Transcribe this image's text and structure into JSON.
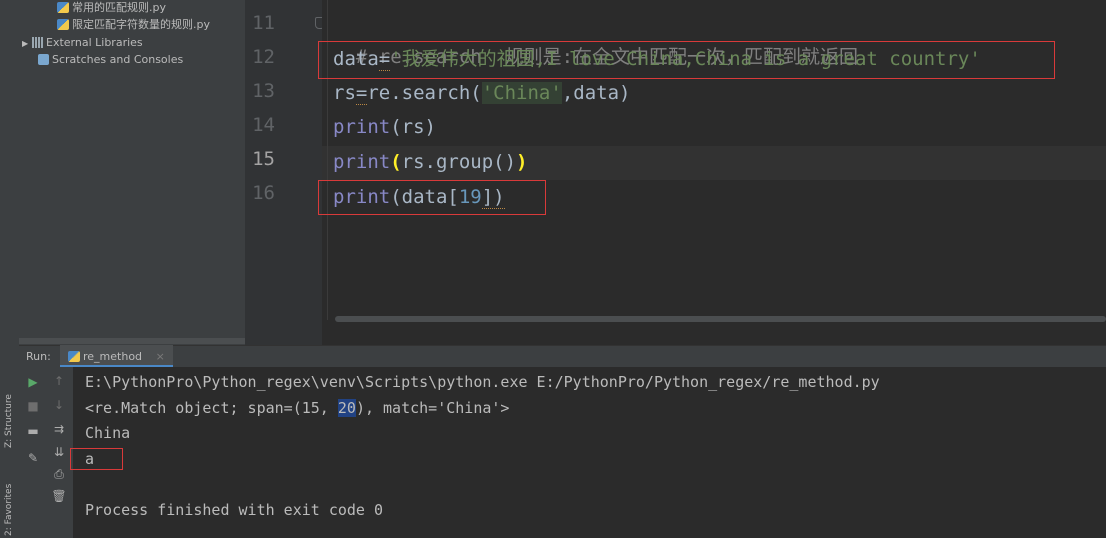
{
  "project_tree": {
    "items": [
      {
        "label": "常用的匹配规则.py",
        "icon": "python-file-icon"
      },
      {
        "label": "限定匹配字符数量的规则.py",
        "icon": "python-file-icon"
      },
      {
        "label": "External Libraries",
        "icon": "library-icon"
      },
      {
        "label": "Scratches and Consoles",
        "icon": "scratches-icon"
      }
    ]
  },
  "editor": {
    "line_numbers": [
      "11",
      "12",
      "13",
      "14",
      "15",
      "16"
    ],
    "current_line": "15",
    "lines": {
      "l11_comment": "# re.search  规则是:在全文中匹配一次，匹配到就返回",
      "l12_var": "data",
      "l12_eq": "=",
      "l12_str": "'我爱伟大的祖国,I love China,China is a great country'",
      "l13_var": "rs",
      "l13_eq": "=",
      "l13_call": "re.search(",
      "l13_str": "'China'",
      "l13_rest": ",data)",
      "l14_fn": "print",
      "l14_rest": "(rs)",
      "l15_fn": "print",
      "l15_open": "(",
      "l15_mid": "rs.group()",
      "l15_close": ")",
      "l16_fn": "print",
      "l16_open": "(data[",
      "l16_num": "19",
      "l16_close": "])"
    }
  },
  "run_panel": {
    "label": "Run:",
    "tab_name": "re_method",
    "tab_close": "×",
    "output": {
      "line1": "E:\\PythonPro\\Python_regex\\venv\\Scripts\\python.exe E:/PythonPro/Python_regex/re_method.py",
      "line2_pre": "<re.Match object; span=(15, ",
      "line2_sel": "20",
      "line2_post": "), match='China'>",
      "line3": "China",
      "line4": "a",
      "line5": "Process finished with exit code 0"
    }
  },
  "side_tabs": {
    "structure": "Z: Structure",
    "favorites": "2: Favorites"
  },
  "colors": {
    "editor_bg": "#2b2b2b",
    "string": "#6a8759",
    "keyword": "#cc7832",
    "number": "#6897bb",
    "builtin": "#8888c6",
    "annotation_box": "#d93a3a"
  }
}
